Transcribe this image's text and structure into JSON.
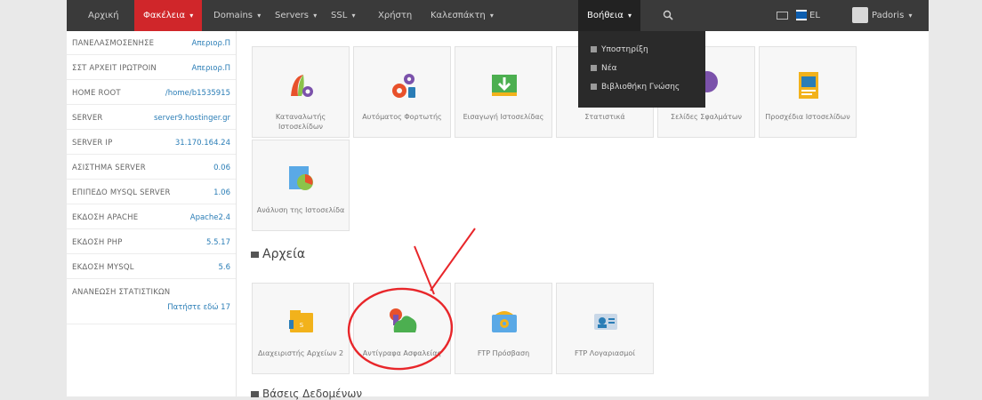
{
  "navbar": {
    "items": [
      {
        "label": "Αρχική",
        "caret": ""
      },
      {
        "label": "Φακέλεια",
        "caret": "▾"
      },
      {
        "label": "Domains",
        "caret": "▾"
      },
      {
        "label": "Servers",
        "caret": "▾"
      },
      {
        "label": "SSL",
        "caret": "▾"
      },
      {
        "label": "Χρήστη",
        "caret": ""
      },
      {
        "label": "Καλεσπάκτη",
        "caret": "▾"
      },
      {
        "label": "Βοήθεια",
        "caret": "▾"
      }
    ],
    "lang": "EL",
    "user": "Padoris",
    "user_caret": "▾",
    "accent": "#d0262a"
  },
  "help_menu": {
    "items": [
      "Υποστηρίξη",
      "Νέα",
      "Βιβλιοθήκη Γνώσης"
    ]
  },
  "sidebar": {
    "stats": [
      {
        "label": "ΠΑΝΕΛΑΣΜΟΣΕΝΗΣΕ",
        "value": "Απεριορ.Π"
      },
      {
        "label": "ΣΣΤ ΑΡΧΕΙΤ ΙΡΩΤΡΟΙΝ",
        "value": "Απεριορ.Π"
      },
      {
        "label": "HOME ROOT",
        "value": "/home/b1535915"
      },
      {
        "label": "SERVER",
        "value": "server9.hostinger.gr"
      },
      {
        "label": "SERVER IP",
        "value": "31.170.164.24"
      },
      {
        "label": "ΑΣΙΣΤΗΜΑ SERVER",
        "value": "0.06"
      },
      {
        "label": "ΕΠΙΠΕΔΟ MYSQL SERVER",
        "value": "1.06"
      },
      {
        "label": "ΕΚΔΟΣΗ APACHE",
        "value": "Apache2.4"
      },
      {
        "label": "ΕΚΔΟΣΗ PHP",
        "value": "5.5.17"
      },
      {
        "label": "ΕΚΔΟΣΗ MYSQL",
        "value": "5.6"
      },
      {
        "label": "ΑΝΑΝΕΩΣΗ ΣΤΑΤΙΣΤΙΚΩΝ",
        "value": "Πατήστε εδώ 17"
      }
    ]
  },
  "main": {
    "top_tiles": [
      {
        "label": "Καταναλωτής Ιστοσελίδων",
        "icon": "site-builder-icon"
      },
      {
        "label": "Αυτόματος Φορτωτής",
        "icon": "auto-installer-icon"
      },
      {
        "label": "Εισαγωγή Ιστοσελίδας",
        "icon": "import-website-icon"
      },
      {
        "label": "Στατιστικά",
        "icon": "statistics-icon"
      },
      {
        "label": "Σελίδες Σφαλμάτων",
        "icon": "error-pages-icon"
      },
      {
        "label": "Προσχέδια Ιστοσελίδων",
        "icon": "website-templates-icon"
      },
      {
        "label": "Ανάλυση της Ιστοσελίδα",
        "icon": "website-analysis-icon"
      }
    ],
    "files_section_title": "Αρχεία",
    "file_tiles": [
      {
        "label": "Διαχειριστής Αρχείων 2",
        "icon": "file-manager-icon"
      },
      {
        "label": "Αντίγραφα Ασφαλείας",
        "icon": "backups-icon"
      },
      {
        "label": "FTP Πρόσβαση",
        "icon": "ftp-access-icon"
      },
      {
        "label": "FTP Λογαριασμοί",
        "icon": "ftp-accounts-icon"
      }
    ],
    "next_section_title": "Βάσεις Δεδομένων"
  }
}
